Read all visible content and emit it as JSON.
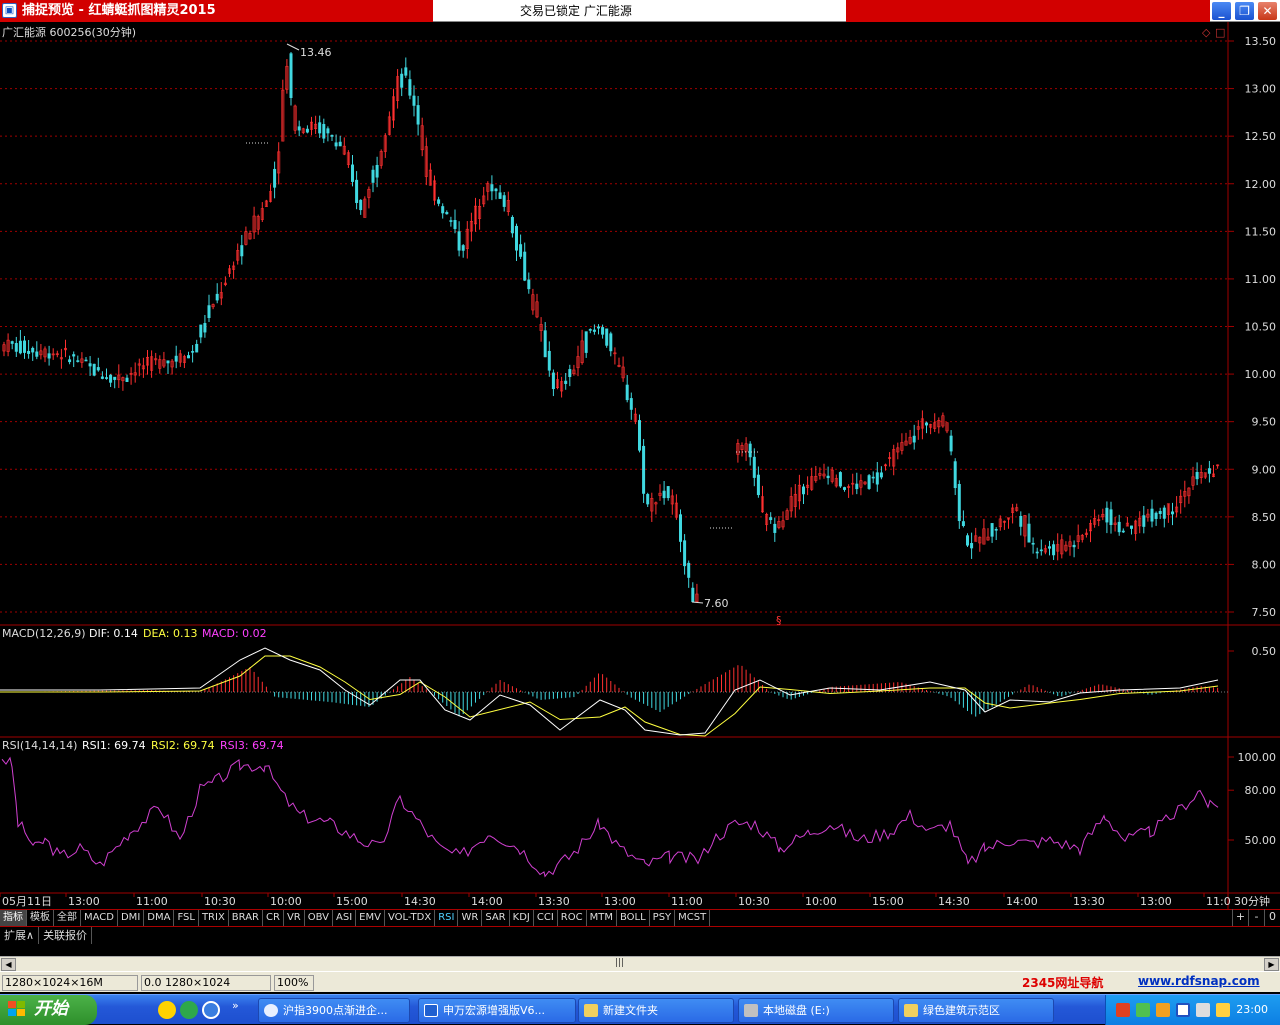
{
  "window": {
    "title": "捕捉预览 - 红蜻蜓抓图精灵2015",
    "center_text": "交易已锁定 广汇能源",
    "buttons": {
      "minimize": "_",
      "restore": "❐",
      "close": "✕"
    }
  },
  "chart": {
    "stock_label": "广汇能源 600256(30分钟)",
    "period": "30分钟",
    "high_label": "13.46",
    "low_label": "7.60",
    "marker": "§",
    "price_ticks": [
      "13.50",
      "13.00",
      "12.50",
      "12.00",
      "11.50",
      "11.00",
      "10.50",
      "10.00",
      "9.50",
      "9.00",
      "8.50",
      "8.00",
      "7.50"
    ],
    "macd": {
      "name": "MACD(12,26,9)",
      "dif": "DIF: 0.14",
      "dea": "DEA: 0.13",
      "macd": "MACD: 0.02",
      "tick": "0.50"
    },
    "rsi": {
      "name": "RSI(14,14,14)",
      "rsi1": "RSI1: 69.74",
      "rsi2": "RSI2: 69.74",
      "rsi3": "RSI3: 69.74",
      "ticks": [
        "100.00",
        "80.00",
        "50.00"
      ]
    },
    "time_axis": [
      "05月11日",
      "13:00",
      "11:00",
      "10:30",
      "10:00",
      "15:00",
      "14:30",
      "14:00",
      "13:30",
      "13:00",
      "11:00",
      "10:30",
      "10:00",
      "15:00",
      "14:30",
      "14:00",
      "13:30",
      "13:00",
      "11:0"
    ]
  },
  "tabs": [
    "指标",
    "模板",
    "全部",
    "MACD",
    "DMI",
    "DMA",
    "FSL",
    "TRIX",
    "BRAR",
    "CR",
    "VR",
    "OBV",
    "ASI",
    "EMV",
    "VOL-TDX",
    "RSI",
    "WR",
    "SAR",
    "KDJ",
    "CCI",
    "ROC",
    "MTM",
    "BOLL",
    "PSY",
    "MCST"
  ],
  "zoom_controls": [
    "+",
    "-",
    "0"
  ],
  "subtabs": [
    "扩展∧",
    "关联报价"
  ],
  "statusbar": {
    "size": "1280×1024×16M",
    "coords": "0.0 1280×1024",
    "zoom": "100%",
    "ad1": "2345网址导航",
    "ad2": "www.rdfsnap.com"
  },
  "taskbar": {
    "start": "开始",
    "tasks": [
      "沪指3900点渐进企...",
      "申万宏源增强版V6...",
      "新建文件夹",
      "本地磁盘 (E:)",
      "绿色建筑示范区"
    ],
    "clock": "23:00"
  },
  "colors": {
    "up": "#ff3030",
    "down": "#40d8e0",
    "grid": "#a00000",
    "dif": "#ffffff",
    "dea": "#ffff40",
    "rsi": "#d040d0"
  }
}
